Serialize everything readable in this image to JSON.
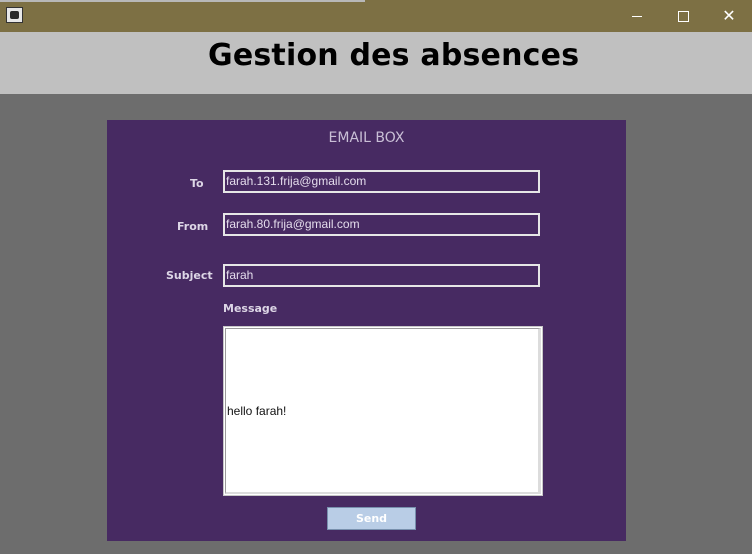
{
  "window": {
    "title_icon": "java-app-icon",
    "controls": {
      "minimize": "minimize-icon",
      "maximize": "maximize-icon",
      "close": "close-icon"
    }
  },
  "header": {
    "title": "Gestion des absences"
  },
  "email_box": {
    "title": "EMAIL BOX",
    "to_label": "To",
    "to_value": "farah.131.frija@gmail.com",
    "from_label": "From",
    "from_value": "farah.80.frija@gmail.com",
    "subject_label": "Subject",
    "subject_value": "farah",
    "message_label": "Message",
    "message_value": "hello farah!",
    "send_label": "Send"
  },
  "colors": {
    "titlebar": "#7d7044",
    "header_bg": "#c0c0c0",
    "background": "#6d6d6d",
    "panel": "#472a62",
    "send_button": "#b9cde6"
  }
}
